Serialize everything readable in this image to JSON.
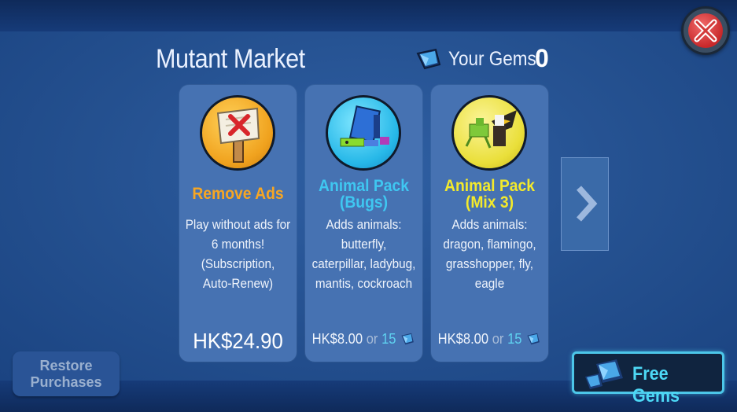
{
  "header": {
    "title": "Mutant Market",
    "gems_label": "Your Gems:",
    "gems_value": "0"
  },
  "cards": [
    {
      "name": "Remove Ads",
      "name_color": "#f7a623",
      "description": [
        "Play without ads for",
        "6 months!",
        "(Subscription,",
        "Auto-Renew)"
      ],
      "price": "HK$24.90"
    },
    {
      "name": [
        "Animal Pack",
        "(Bugs)"
      ],
      "name_color": "#3fc7f1",
      "description": [
        "Adds animals:",
        "butterfly,",
        "caterpillar, ladybug,",
        "mantis, cockroach"
      ],
      "price": "HK$8.00",
      "or": "or",
      "gem_price": "15"
    },
    {
      "name": [
        "Animal Pack",
        "(Mix 3)"
      ],
      "name_color": "#f4ea2b",
      "description": [
        "Adds animals:",
        "dragon, flamingo,",
        "grasshopper, fly,",
        "eagle"
      ],
      "price": "HK$8.00",
      "or": "or",
      "gem_price": "15"
    }
  ],
  "buttons": {
    "restore": [
      "Restore",
      "Purchases"
    ],
    "free_gems": "Free Gems"
  },
  "icons": {
    "close": "close-icon",
    "gem": "gem-icon",
    "next": "chevron-right-icon"
  }
}
